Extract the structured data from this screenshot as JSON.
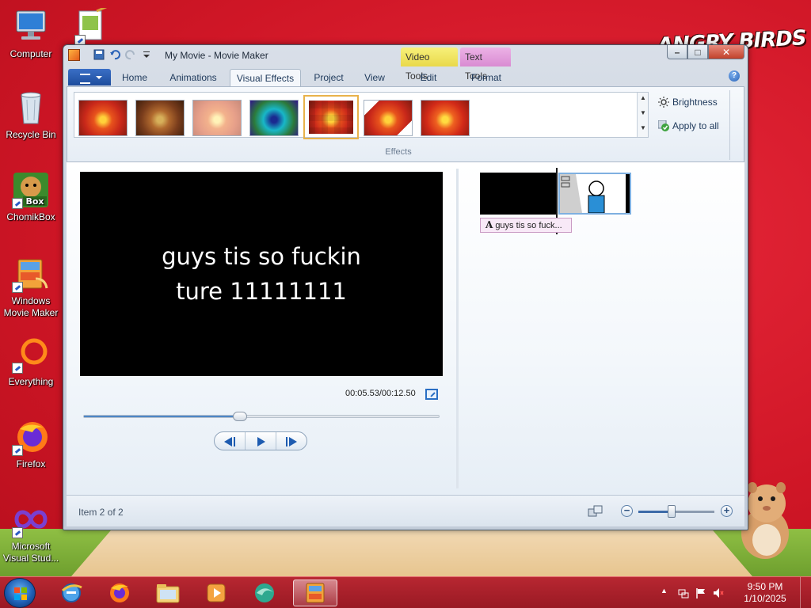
{
  "desktop": {
    "icons": [
      {
        "label_line1": "Computer",
        "label_line2": "",
        "icon": "computer-icon"
      },
      {
        "label_line1": "Recycle Bin",
        "label_line2": "",
        "icon": "recycle-bin-icon"
      },
      {
        "label_line1": "ChomikBox",
        "label_line2": "",
        "icon": "chomikbox-icon"
      },
      {
        "label_line1": "Windows",
        "label_line2": "Movie Maker",
        "icon": "movie-maker-icon"
      },
      {
        "label_line1": "Everything",
        "label_line2": "",
        "icon": "everything-icon"
      },
      {
        "label_line1": "Firefox",
        "label_line2": "",
        "icon": "firefox-icon"
      },
      {
        "label_line1": "Microsoft",
        "label_line2": "Visual Stud...",
        "icon": "visual-studio-icon"
      }
    ],
    "logo_text": "ANGRY BIRDS"
  },
  "window": {
    "title": "My Movie - Movie Maker",
    "context_tabs": {
      "video_tools": "Video Tools",
      "text_tools": "Text Tools"
    },
    "tabs": [
      {
        "label": "Home"
      },
      {
        "label": "Animations"
      },
      {
        "label": "Visual Effects",
        "active": true
      },
      {
        "label": "Project"
      },
      {
        "label": "View"
      },
      {
        "label": "Edit"
      },
      {
        "label": "Format"
      }
    ],
    "help": "?"
  },
  "ribbon": {
    "effects_group_label": "Effects",
    "effects": [
      {
        "name": "effect-none",
        "selected": false
      },
      {
        "name": "effect-sepia",
        "selected": false
      },
      {
        "name": "effect-fade-light",
        "selected": false
      },
      {
        "name": "effect-cyan-tone",
        "selected": false
      },
      {
        "name": "effect-pixelate",
        "selected": true
      },
      {
        "name": "effect-rotate",
        "selected": false
      },
      {
        "name": "effect-edge",
        "selected": false
      }
    ],
    "brightness_label": "Brightness",
    "apply_all_label": "Apply to all"
  },
  "preview": {
    "caption_line1": "guys tis so fuckin",
    "caption_line2": "ture 11111111",
    "timecode": "00:05.53/00:12.50",
    "seek_fraction": 0.44
  },
  "storyboard": {
    "caption_clip": "guys tis so fuck..."
  },
  "statusbar": {
    "item_text": "Item 2 of 2",
    "zoom_fraction": 0.44
  },
  "taskbar": {
    "apps": [
      "internet-explorer-icon",
      "firefox-icon",
      "file-explorer-icon",
      "media-player-icon",
      "globe-app-icon",
      "movie-maker-icon"
    ],
    "time": "9:50 PM",
    "date": "1/10/2025"
  }
}
